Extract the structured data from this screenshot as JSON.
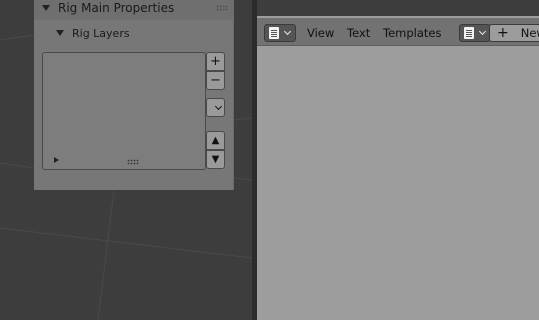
{
  "panel": {
    "title": "Rig Main Properties",
    "subpanel_title": "Rig Layers",
    "buttons": {
      "add": "+",
      "remove": "−",
      "menu": "⌄",
      "up": "▲",
      "down": "▼"
    }
  },
  "text_editor": {
    "menu": [
      "View",
      "Text",
      "Templates"
    ],
    "new_label": "New",
    "new_icon": "+"
  },
  "icons": {
    "editor_type": "text-editor-icon",
    "chevron": "chevron-down-icon"
  },
  "colors": {
    "viewport_bg": "#3d3d3d",
    "panel_bg": "#777777",
    "text_editor_bg": "#9d9d9d",
    "header_bg": "#727272"
  }
}
